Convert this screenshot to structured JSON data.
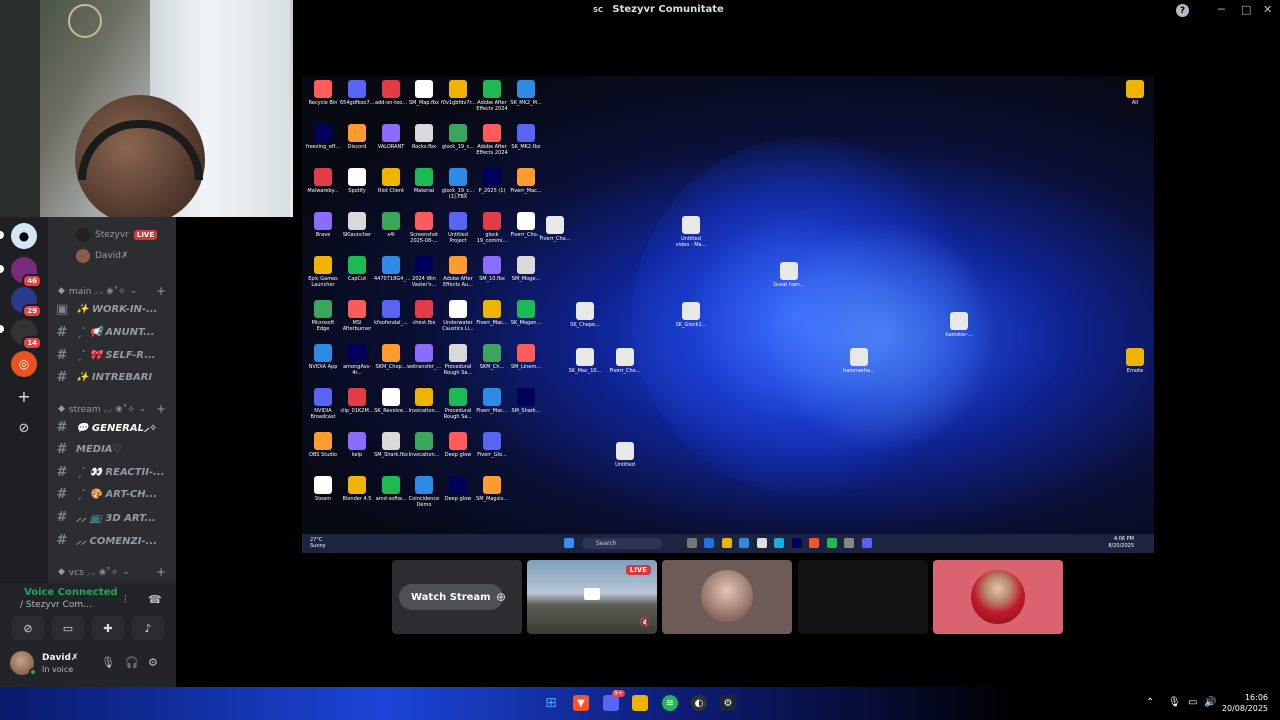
{
  "window": {
    "title": "Stezyvr Comunitate",
    "title_icon": "SC"
  },
  "voice_users": [
    {
      "name": "Stezyvr",
      "live_label": "LIVE"
    },
    {
      "name": "David✗"
    }
  ],
  "categories": [
    {
      "name": "main ⸝⸝ ❀˚✧"
    },
    {
      "name": "stream ⸝⸝ ❀˚✧"
    },
    {
      "name": "vcs ⸝⸝ ❀˚✧"
    }
  ],
  "channels": [
    {
      "label": "✨ WORK-IN-..."
    },
    {
      "label": "ˏˋ 📢 ANUNT..."
    },
    {
      "label": "ˏˋ 🎀 SELF-R..."
    },
    {
      "label": "✨ INTREBARI"
    },
    {
      "label": "💬 GENERAL⸝✧"
    },
    {
      "label": "MEDIA♡"
    },
    {
      "label": "ˏˋ 👀 REACTII-..."
    },
    {
      "label": "ˏˋ 🎨 ART-CH..."
    },
    {
      "label": "⸝⸝ 📺 3D ART..."
    },
    {
      "label": "⸝⸝ COMENZI-..."
    }
  ],
  "guild_badges": [
    "46",
    "29",
    "14"
  ],
  "voice_panel": {
    "status": "Voice Connected",
    "channel": "/ Stezyvr Com..."
  },
  "user": {
    "name": "David✗",
    "status": "In voice"
  },
  "stream": {
    "desktop_icons": [
      "Recycle Bin",
      "654gdfkoo7...",
      "add-on-too...",
      "SM_Map.fbx",
      "f0v1gbfdv7r...",
      "Adobe After Effects 2024",
      "SK_MK2_M...",
      "freezing_eff...",
      "Discord",
      "VALORANT",
      "Rocks.fbx",
      "glock_19_c...",
      "Adobe After Effects 2024",
      "SK_MK2.fbx",
      "Malwareby...",
      "Spotify",
      "Riot Client",
      "Material",
      "glock_19_c... (1).FBX",
      "P_2025 (1)",
      "Fiverr_Mac...",
      "Brave",
      "SKlauncher",
      "s4l",
      "Screenshot 2025-08-...",
      "Untitled Project",
      "glock 19_commi...",
      "Fiverr_Cho...",
      "Epic Games Launcher",
      "CapCut",
      "4470718G4_...",
      "2024 Win Vaster's...",
      "Adobe After Effects Au...",
      "SM_10.fbx",
      "SM_Moge...",
      "Microsoft Edge",
      "MSI Afterburner",
      "kfoofendal_...",
      "chest.fbx",
      "Underwater Caustics Li...",
      "Fiverr_Mac...",
      "SK_Mogen...",
      "NVIDIA App",
      "amongAss-4r...",
      "SKM_Chop...",
      "wetransfer_...",
      "Procedural Rough Sa...",
      "SKM_Ch...",
      "SM_Linem...",
      "NVIDIA Broadcast",
      "clip_01K2M...",
      "SK_Revolve...",
      "Invocation...",
      "Procedural Rough Sa...",
      "Fiverr_Mac...",
      "SM_Shark...",
      "OBS Studio",
      "kelp",
      "SM_Shark.fbx",
      "Invocation...",
      "Deep glow",
      "Fiverr_Glo...",
      "Steam",
      "Blender 4.5",
      "amd-softw...",
      "Coincidence Demo",
      "Deep glow",
      "SM_Magsis...",
      "All",
      "Emote",
      "Great ham...",
      "hamster-...",
      "hammerhe...",
      "Untitled video - Ma...",
      "Fiverr_Cho...",
      "SK_Chepe...",
      "SK_Glock1...",
      "SK_Mac_10...",
      "Fiverr_Cho...",
      "Untitled"
    ],
    "search_placeholder": "Search",
    "weather": {
      "temp": "27°C",
      "desc": "Sunny"
    },
    "clock": {
      "time": "4:06 PM",
      "date": "8/20/2025"
    }
  },
  "tiles": {
    "watch_label": "Watch Stream",
    "live_label": "LIVE"
  },
  "taskbar": {
    "clock_time": "16:06",
    "clock_date": "20/08/2025",
    "discord_badge": "9+"
  },
  "colors": {
    "accent": "#5865f2",
    "live": "#da373c",
    "online": "#23a55a",
    "tile_red": "#d9646f"
  }
}
